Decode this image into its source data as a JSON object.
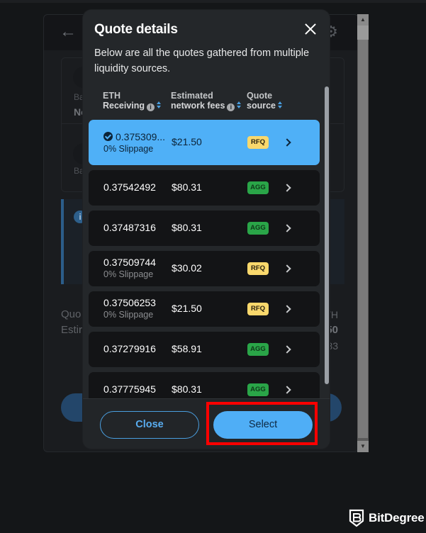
{
  "background": {
    "back_icon": "arrow-left-icon",
    "settings_icon": "gear-icon",
    "card": {
      "balance_label_1": "Ba",
      "value_1": "No",
      "balance_label_2": "Ba"
    },
    "info_icon": "info-icon",
    "quote_label": "Quo",
    "estimated_label": "Estir",
    "right_top": "TH",
    "right_mid": "50",
    "right_bottom": "83"
  },
  "modal": {
    "title": "Quote details",
    "close_icon": "close-icon",
    "description": "Below are all the quotes gathered from multiple liquidity sources.",
    "columns": [
      {
        "line1": "ETH",
        "line2": "Receiving",
        "info": true,
        "sort": true
      },
      {
        "line1": "Estimated",
        "line2": "network fees",
        "info": true,
        "sort": true
      },
      {
        "line1": "Quote",
        "line2": "source",
        "info": false,
        "sort": true
      }
    ],
    "quotes": [
      {
        "amount": "0.375309...",
        "slippage": "0% Slippage",
        "fee": "$21.50",
        "source": "RFQ",
        "selected": true,
        "verified": true
      },
      {
        "amount": "0.37542492",
        "slippage": "",
        "fee": "$80.31",
        "source": "AGG",
        "selected": false,
        "verified": false
      },
      {
        "amount": "0.37487316",
        "slippage": "",
        "fee": "$80.31",
        "source": "AGG",
        "selected": false,
        "verified": false
      },
      {
        "amount": "0.37509744",
        "slippage": "0% Slippage",
        "fee": "$30.02",
        "source": "RFQ",
        "selected": false,
        "verified": false
      },
      {
        "amount": "0.37506253",
        "slippage": "0% Slippage",
        "fee": "$21.50",
        "source": "RFQ",
        "selected": false,
        "verified": false
      },
      {
        "amount": "0.37279916",
        "slippage": "",
        "fee": "$58.91",
        "source": "AGG",
        "selected": false,
        "verified": false
      },
      {
        "amount": "0.37775945",
        "slippage": "",
        "fee": "$80.31",
        "source": "AGG",
        "selected": false,
        "verified": false
      }
    ],
    "buttons": {
      "close": "Close",
      "select": "Select"
    }
  },
  "colors": {
    "accent": "#4faef6",
    "agg_badge": "#2aa548",
    "rfq_badge": "#f9d86c",
    "highlight": "#ff0000"
  },
  "watermark": {
    "brand": "BitDegree",
    "icon": "bitdegree-shield-icon"
  }
}
